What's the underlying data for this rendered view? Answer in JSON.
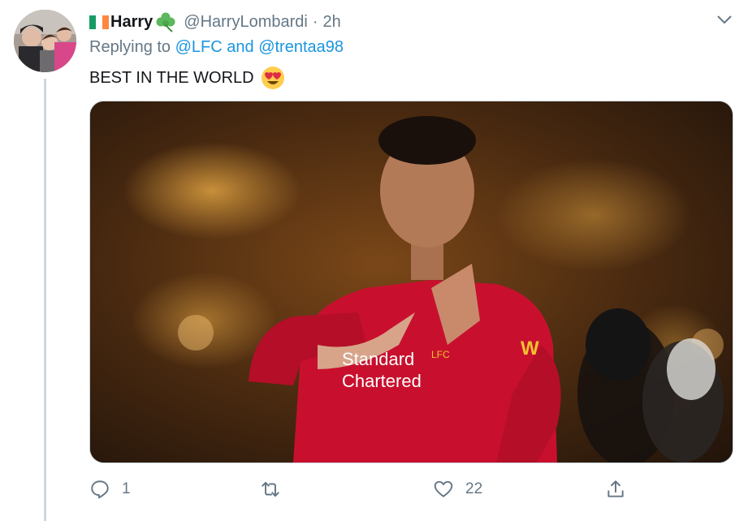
{
  "tweet": {
    "display_name": "Harry",
    "flag_icon": "ireland-flag-icon",
    "emoji_icon": "shamrock-icon",
    "handle": "@HarryLombardi",
    "separator": "·",
    "time": "2h",
    "replying_prefix": "Replying to",
    "replying_to": "@LFC and @trentaa98",
    "text": "BEST IN THE WORLD",
    "text_emoji": "heart-eyes-emoji",
    "media": {
      "shirt_text_line1": "Standard",
      "shirt_text_line2": "Chartered",
      "sponsor": "W",
      "crest_text": "LFC"
    },
    "actions": {
      "reply_count": "1",
      "retweet_count": "",
      "like_count": "22"
    }
  },
  "colors": {
    "link": "#1b95e0",
    "secondary_text": "#657786",
    "thread_line": "#ccd6dd",
    "shirt_red": "#c8102e"
  }
}
